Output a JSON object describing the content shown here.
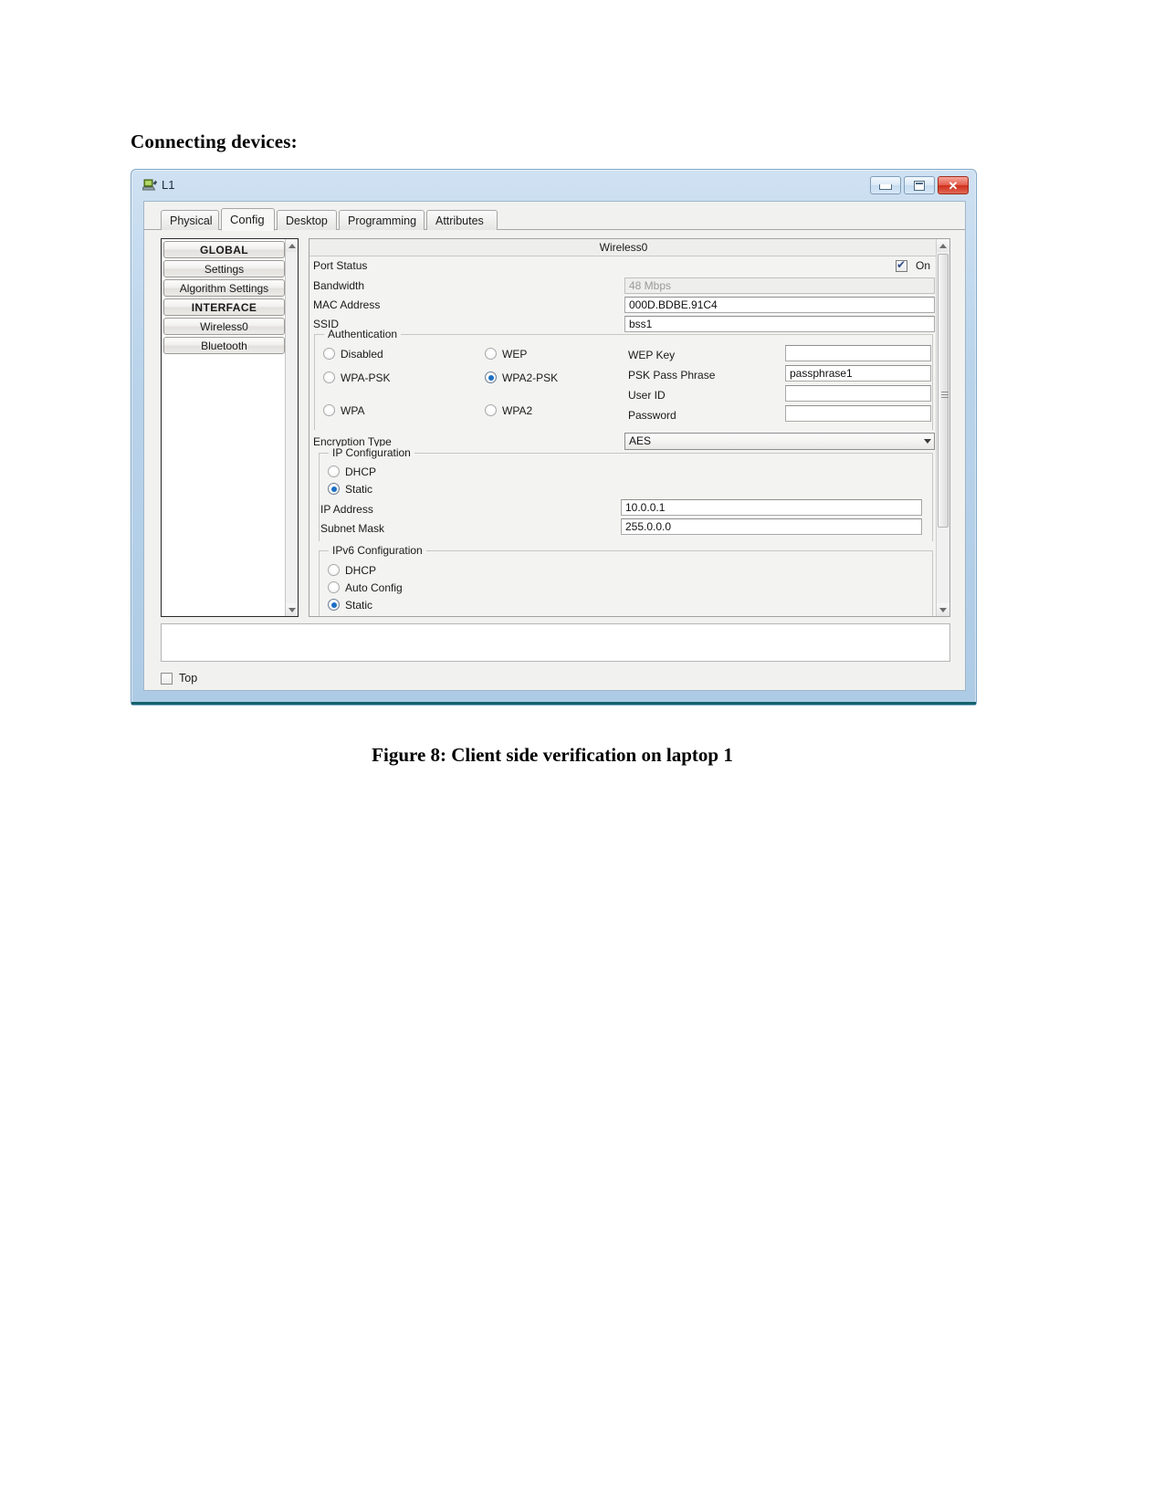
{
  "document": {
    "heading": "Connecting devices:",
    "figure_caption": "Figure 8: Client side verification on laptop 1"
  },
  "window": {
    "title": "L1",
    "icon": "laptop-icon",
    "controls": {
      "minimize": "minimize-icon",
      "maximize": "maximize-icon",
      "close": "✕"
    }
  },
  "tabs": [
    {
      "label": "Physical",
      "active": false
    },
    {
      "label": "Config",
      "active": true
    },
    {
      "label": "Desktop",
      "active": false
    },
    {
      "label": "Programming",
      "active": false
    },
    {
      "label": "Attributes",
      "active": false
    }
  ],
  "sidebar": {
    "items": [
      {
        "label": "GLOBAL",
        "type": "section"
      },
      {
        "label": "Settings",
        "type": "item"
      },
      {
        "label": "Algorithm Settings",
        "type": "item"
      },
      {
        "label": "INTERFACE",
        "type": "section"
      },
      {
        "label": "Wireless0",
        "type": "item"
      },
      {
        "label": "Bluetooth",
        "type": "item"
      }
    ]
  },
  "panel": {
    "header": "Wireless0",
    "port_status": {
      "label": "Port Status",
      "on_label": "On",
      "checked": true
    },
    "bandwidth": {
      "label": "Bandwidth",
      "value": "48 Mbps",
      "disabled": true
    },
    "mac_address": {
      "label": "MAC Address",
      "value": "000D.BDBE.91C4"
    },
    "ssid": {
      "label": "SSID",
      "value": "bss1"
    },
    "authentication": {
      "title": "Authentication",
      "options": [
        {
          "label": "Disabled",
          "selected": false
        },
        {
          "label": "WEP",
          "selected": false
        },
        {
          "label": "WPA-PSK",
          "selected": false
        },
        {
          "label": "WPA2-PSK",
          "selected": true
        },
        {
          "label": "WPA",
          "selected": false
        },
        {
          "label": "WPA2",
          "selected": false
        }
      ],
      "fields": [
        {
          "label": "WEP Key",
          "value": ""
        },
        {
          "label": "PSK Pass Phrase",
          "value": "passphrase1"
        },
        {
          "label": "User ID",
          "value": ""
        },
        {
          "label": "Password",
          "value": ""
        }
      ]
    },
    "encryption_type": {
      "label": "Encryption Type",
      "value": "AES"
    },
    "ip_configuration": {
      "title": "IP Configuration",
      "options": [
        {
          "label": "DHCP",
          "selected": false
        },
        {
          "label": "Static",
          "selected": true
        }
      ],
      "ip_address": {
        "label": "IP Address",
        "value": "10.0.0.1"
      },
      "subnet_mask": {
        "label": "Subnet Mask",
        "value": "255.0.0.0"
      }
    },
    "ipv6_configuration": {
      "title": "IPv6 Configuration",
      "options": [
        {
          "label": "DHCP",
          "selected": false
        },
        {
          "label": "Auto Config",
          "selected": false
        },
        {
          "label": "Static",
          "selected": true
        }
      ]
    }
  },
  "footer": {
    "top_checkbox": {
      "label": "Top",
      "checked": false
    }
  }
}
